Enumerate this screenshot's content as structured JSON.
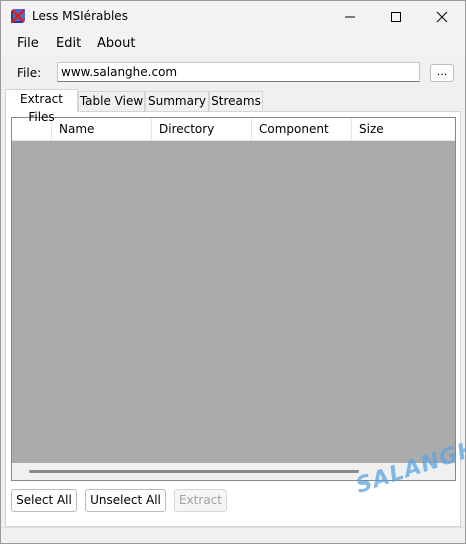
{
  "window": {
    "title": "Less MSIérables"
  },
  "menu": {
    "items": [
      {
        "label": "File"
      },
      {
        "label": "Edit"
      },
      {
        "label": "About"
      }
    ]
  },
  "file_row": {
    "label": "File:",
    "value": "www.salanghe.com",
    "browse_label": "..."
  },
  "tabs": [
    {
      "label": "Extract Files",
      "active": true
    },
    {
      "label": "Table View",
      "active": false
    },
    {
      "label": "Summary",
      "active": false
    },
    {
      "label": "Streams",
      "active": false
    }
  ],
  "listview": {
    "columns": [
      "",
      "Name",
      "Directory",
      "Component",
      "Size"
    ],
    "rows": []
  },
  "buttons": {
    "select_all": "Select All",
    "unselect_all": "Unselect All",
    "extract": "Extract"
  },
  "watermark": "SALANGHE",
  "colors": {
    "list_background": "#ababab",
    "watermark": "#5ba4e0"
  }
}
